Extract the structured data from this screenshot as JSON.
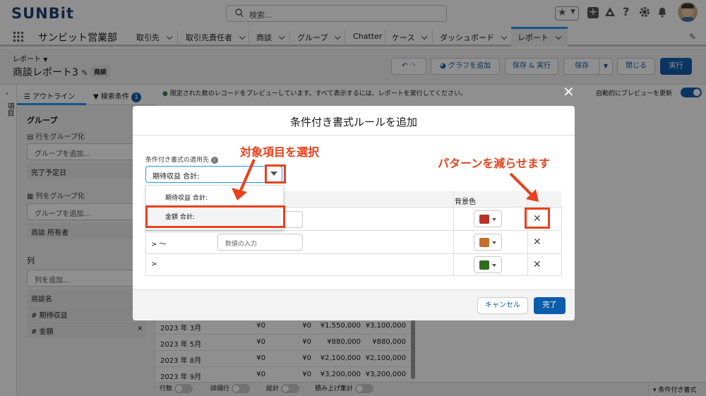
{
  "header": {
    "logo": "SUNBit",
    "search_placeholder": "検索...",
    "app_name": "サンビット営業部",
    "nav_items": [
      "取引先",
      "取引先責任者",
      "商談",
      "グループ",
      "Chatter",
      "ケース",
      "ダッシュボード",
      "レポート"
    ]
  },
  "page": {
    "breadcrumb": "レポート",
    "title": "商談レポート3",
    "tag": "商談",
    "buttons": {
      "add_chart": "グラフを追加",
      "save_run": "保存 & 実行",
      "save": "保存",
      "close": "閉じる",
      "run": "実行"
    }
  },
  "left_panel": {
    "tab_fields": "項目",
    "tab_outline": "アウトライン",
    "tab_filters": "検索条件",
    "filter_count": "1",
    "group_heading": "グループ",
    "group_rows_label": "行をグループ化",
    "group_rows_placeholder": "グループを追加...",
    "group_rows_field": "完了予定日",
    "group_cols_label": "列をグループ化",
    "group_cols_placeholder": "グループを追加...",
    "group_cols_field": "商談 所有者",
    "columns_heading": "列",
    "columns_placeholder": "列を追加...",
    "columns": [
      "商談名",
      "# 期待収益",
      "# 金額"
    ]
  },
  "preview": {
    "notice": "限定された数のレコードをプレビューしています。すべて表示するには、レポートを実行してください。",
    "auto_update_label": "自動的にプレビューを更新"
  },
  "table": {
    "rows": [
      {
        "date": "2023 年 3月",
        "c1": "¥0",
        "c2": "¥0",
        "c3": "¥1,550,000",
        "c4": "¥3,100,000"
      },
      {
        "date": "2023 年 5月",
        "c1": "¥0",
        "c2": "¥0",
        "c3": "¥880,000",
        "c4": "¥880,000"
      },
      {
        "date": "2023 年 8月",
        "c1": "¥0",
        "c2": "¥0",
        "c3": "¥2,100,000",
        "c4": "¥2,100,000"
      },
      {
        "date": "2023 年 9月",
        "c1": "¥0",
        "c2": "¥0",
        "c3": "¥3,200,000",
        "c4": "¥3,200,000"
      }
    ]
  },
  "footer": {
    "row_count": "行数",
    "detail_rows": "詳細行",
    "totals": "総計",
    "stacked": "積み上げ集計",
    "conditional": "条件付き書式"
  },
  "modal": {
    "title": "条件付き書式ルールを追加",
    "apply_label": "条件付き書式の適用先",
    "selected": "期待収益 合計:",
    "options": [
      "期待収益 合計:",
      "金額 合計:"
    ],
    "bg_header": "背景色",
    "rule_ops": [
      "",
      "> 〜",
      ">"
    ],
    "value_placeholder": "数値の入力",
    "colors": [
      "#b8342a",
      "#c2702c",
      "#2f6b1f"
    ],
    "cancel": "キャンセル",
    "done": "完了"
  },
  "annotations": {
    "select_field": "対象項目を選択",
    "reduce_patterns": "パターンを減らせます"
  }
}
